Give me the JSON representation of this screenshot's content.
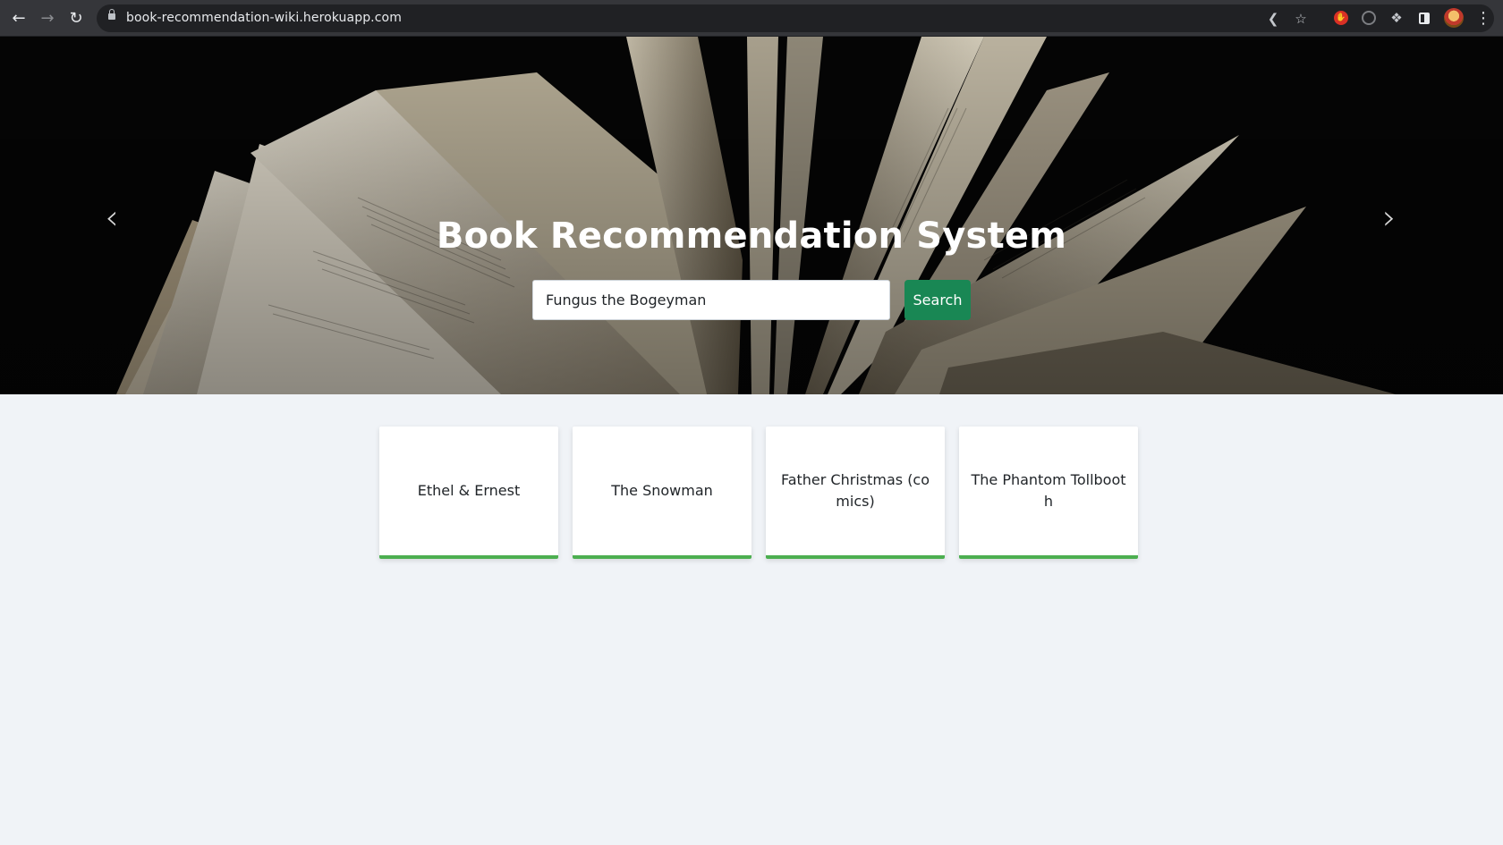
{
  "browser": {
    "url": "book-recommendation-wiki.herokuapp.com",
    "icons": [
      "back-icon",
      "forward-icon",
      "reload-icon",
      "lock-icon",
      "share-icon",
      "bookmark-star-icon",
      "extension-red-icon",
      "extension-ring-icon",
      "extensions-puzzle-icon",
      "side-panel-icon",
      "profile-avatar",
      "more-menu-icon"
    ]
  },
  "hero": {
    "title": "Book Recommendation System",
    "search": {
      "value": "Fungus the Bogeyman",
      "button_label": "Search"
    }
  },
  "recommendations": [
    {
      "title": "Ethel & Ernest"
    },
    {
      "title": "The Snowman"
    },
    {
      "title": "Father Christmas (comics)"
    },
    {
      "title": "The Phantom Tollbooth"
    }
  ],
  "colors": {
    "search_button": "#198754",
    "card_accent": "#4caf50",
    "page_background": "#f0f3f7",
    "hero_background": "#050505"
  }
}
